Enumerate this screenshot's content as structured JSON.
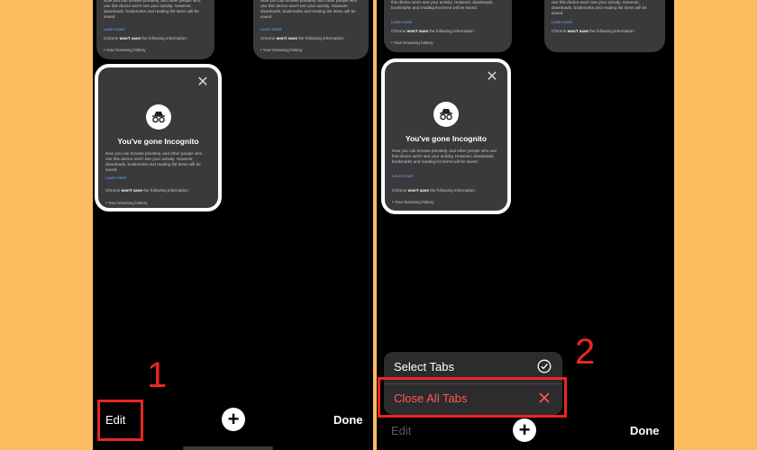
{
  "card": {
    "title": "You've gone Incognito",
    "body": "Now you can browse privately, and other people who use this device won't see your activity. However, downloads, bookmarks and reading list items will be saved.",
    "link": "Learn more",
    "save_pre": "Chrome",
    "save_bold": "won't save",
    "save_post": "the following information:",
    "list_item": "• Your browsing history"
  },
  "card_top": {
    "body": "Now you can browse privately, and other people who use this device won't see your activity. However, downloads, bookmarks and reading list items will be saved.",
    "link": "Learn more",
    "save_pre": "Chrome",
    "save_bold": "won't save",
    "save_post": "the following information:",
    "list_item": "• Your browsing history"
  },
  "toolbar": {
    "edit_label": "Edit",
    "plus_label": "+",
    "done_label": "Done"
  },
  "menu": {
    "select_tabs": "Select Tabs",
    "close_all_tabs": "Close All Tabs"
  },
  "annotations": {
    "step1": "1",
    "step2": "2"
  },
  "colors": {
    "background": "#fbbd5f",
    "annotation": "#e8281e",
    "destructive": "#ff5a4f",
    "link": "#64a8ff"
  },
  "icons": {
    "incognito": "incognito-icon",
    "close": "close-icon",
    "plus": "plus-icon",
    "check": "check-circle-icon"
  }
}
